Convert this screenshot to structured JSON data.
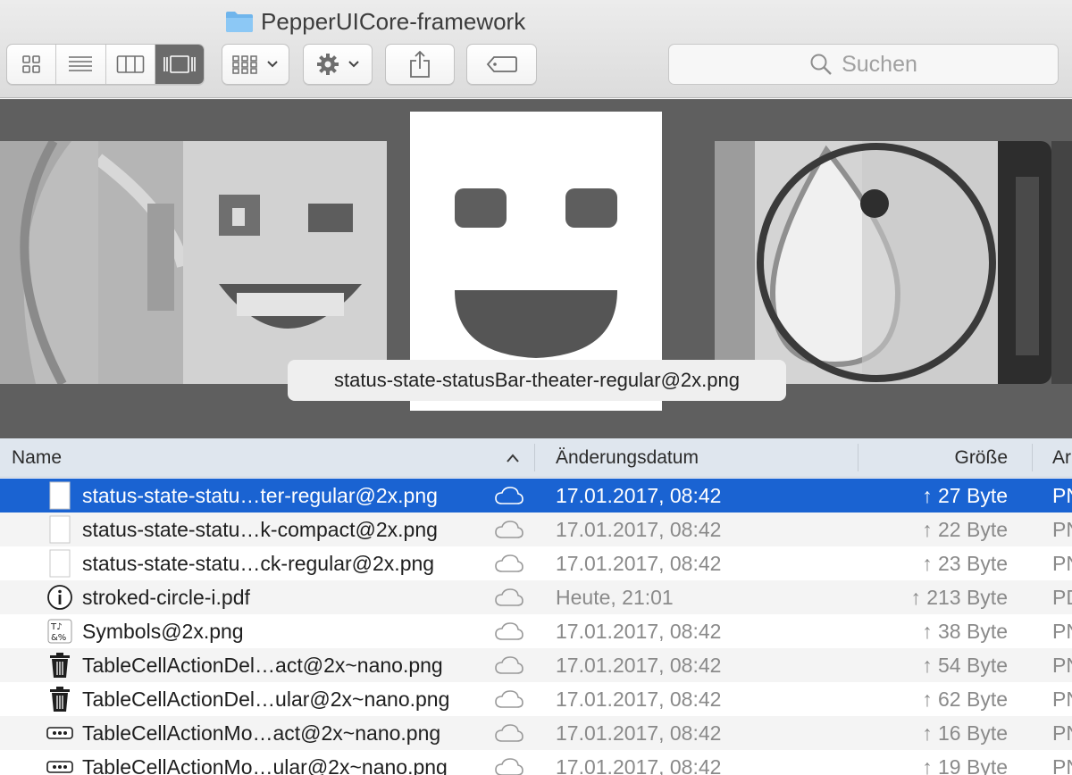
{
  "window": {
    "title": "PepperUICore-framework"
  },
  "toolbar": {
    "view_modes": [
      {
        "name": "icon-view-icon",
        "active": false
      },
      {
        "name": "list-view-icon",
        "active": false
      },
      {
        "name": "column-view-icon",
        "active": false
      },
      {
        "name": "cover-flow-view-icon",
        "active": true
      }
    ],
    "arrange_icon": "grid-arrange-icon",
    "action_icon": "gear-icon",
    "share_icon": "share-icon",
    "tag_icon": "tag-icon",
    "search": {
      "placeholder": "Suchen",
      "icon": "search-icon"
    }
  },
  "coverflow": {
    "caption": "status-state-statusBar-theater-regular@2x.png"
  },
  "list": {
    "columns": {
      "name": "Name",
      "date": "Änderungsdatum",
      "size": "Größe",
      "kind": "Ar"
    },
    "sort_indicator": "chevron-up-icon",
    "rows": [
      {
        "icon": "png-file-icon",
        "name": "status-state-statu…ter-regular@2x.png",
        "date": "17.01.2017, 08:42",
        "size": "↑ 27 Byte",
        "kind": "PN",
        "selected": true
      },
      {
        "icon": "png-file-icon",
        "name": "status-state-statu…k-compact@2x.png",
        "date": "17.01.2017, 08:42",
        "size": "↑ 22 Byte",
        "kind": "PN",
        "selected": false
      },
      {
        "icon": "png-file-icon",
        "name": "status-state-statu…ck-regular@2x.png",
        "date": "17.01.2017, 08:42",
        "size": "↑ 23 Byte",
        "kind": "PN",
        "selected": false
      },
      {
        "icon": "info-circle-icon",
        "name": "stroked-circle-i.pdf",
        "date": "Heute, 21:01",
        "size": "↑ 213 Byte",
        "kind": "PD",
        "selected": false
      },
      {
        "icon": "symbols-icon",
        "name": "Symbols@2x.png",
        "date": "17.01.2017, 08:42",
        "size": "↑ 38 Byte",
        "kind": "PN",
        "selected": false
      },
      {
        "icon": "trash-icon",
        "name": "TableCellActionDel…act@2x~nano.png",
        "date": "17.01.2017, 08:42",
        "size": "↑ 54 Byte",
        "kind": "PN",
        "selected": false
      },
      {
        "icon": "trash-icon",
        "name": "TableCellActionDel…ular@2x~nano.png",
        "date": "17.01.2017, 08:42",
        "size": "↑ 62 Byte",
        "kind": "PN",
        "selected": false
      },
      {
        "icon": "ellipsis-icon",
        "name": "TableCellActionMo…act@2x~nano.png",
        "date": "17.01.2017, 08:42",
        "size": "↑ 16 Byte",
        "kind": "PN",
        "selected": false
      },
      {
        "icon": "ellipsis-icon",
        "name": "TableCellActionMo…ular@2x~nano.png",
        "date": "17.01.2017, 08:42",
        "size": "↑ 19 Byte",
        "kind": "PN",
        "selected": false
      }
    ]
  }
}
